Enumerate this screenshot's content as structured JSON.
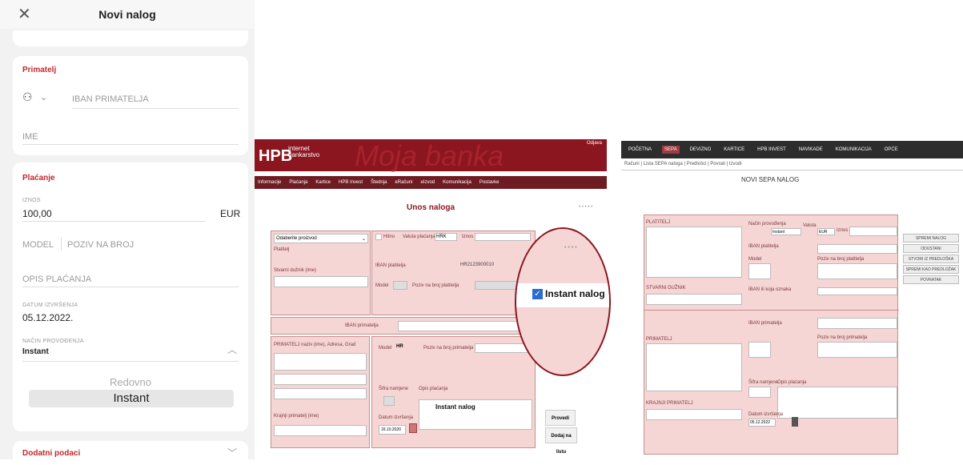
{
  "mobile": {
    "title": "Novi nalog",
    "primatelj_title": "Primatelj",
    "iban_placeholder": "IBAN PRIMATELJA",
    "ime_placeholder": "IME",
    "placanje_title": "Plaćanje",
    "iznos_label": "IZNOS",
    "iznos_value": "100,00",
    "currency": "EUR",
    "model_label": "MODEL",
    "poziv_label": "POZIV NA BROJ",
    "opis_label": "OPIS PLAĆANJA",
    "datum_label": "DATUM IZVRŠENJA",
    "datum_value": "05.12.2022.",
    "nacin_label": "NAČIN PROVOĐENJA",
    "nacin_value": "Instant",
    "option_redovno": "Redovno",
    "option_instant": "Instant",
    "dodatni": "Dodatni podaci"
  },
  "hpb_old": {
    "logo": "HPB",
    "logo_sub1": "internet",
    "logo_sub2": "bankarstvo",
    "watermark": "Moja banka",
    "odjava": "Odjava",
    "nav": [
      "Informacije",
      "Plaćanja",
      "Kartice",
      "HPB Invest",
      "Štednja",
      "eRačuni",
      "eIzvod",
      "Komunikacija",
      "Postavke"
    ],
    "page_title": "Unos naloga",
    "select_racun": "Odaberite proizvod",
    "hitno": "Hitno",
    "valuta_label": "Valuta plaćanja",
    "valuta": "HRK",
    "iznos_label": "Iznos",
    "platitelj": "Platitelj",
    "iban_platitelja_label": "IBAN platitelja",
    "iban_platitelja": "HR2123900010",
    "stvarni_duznik": "Stvarni dužnik (ime)",
    "model_label": "Model",
    "poziv_platitelja": "Poziv na broj platitelja",
    "iban_primatelja": "IBAN primatelja",
    "primatelj": "PRIMATELJ naziv (ime), Adresa, Grad",
    "model_primatelja": "Model",
    "model_hr": "HR",
    "poziv_primatelja": "Poziv na broj primatelja",
    "sifra_namjene": "Šifra namjene",
    "opis_placanja": "Opis plaćanja",
    "krajnji": "Krajnji primatelj (ime)",
    "datum_label": "Datum izvršenja",
    "datum": "16.10.2020",
    "instant_note": "Instant nalog",
    "zoom_checkbox": "Instant nalog",
    "btn_provedi": "Provedi",
    "btn_dodaj": "Dodaj na listu"
  },
  "hpb_sepa": {
    "nav": [
      "POČETNA",
      "SEPA",
      "DEVIZNO",
      "KARTICE",
      "HPB INVEST",
      "NAVIKADE",
      "KOMUNIKACIJA",
      "OPĆE"
    ],
    "nav_active": 1,
    "crumbs": "Računi  |  Lista SEPA naloga  |  Predlošci  |  Povrati  |  Izvodi",
    "title": "NOVI SEPA NALOG",
    "platitelj": "PLATITELJ",
    "nacin": "Način provođenja",
    "nacin_value": "Instant",
    "valuta": "Valuta",
    "valuta_value": "EUR",
    "iznos": "Iznos",
    "iban_platitelja": "IBAN platitelja",
    "model": "Model",
    "poziv_platitelja": "Poziv na broj platitelja",
    "stvarni_duznik": "STVARNI DUŽNIK",
    "bank_duznika": "IBAN ili koja oznaka",
    "iban_primatelja": "IBAN primatelja",
    "primatelj": "PRIMATELJ",
    "poziv_primatelja": "Poziv na broj primatelja",
    "sifra_namjene": "Šifra namjene",
    "opis_placanja": "Opis plaćanja",
    "krajnji": "KRAJNJI PRIMATELJ",
    "datum_label": "Datum izvršenja",
    "datum": "05.12.2022",
    "buttons": [
      "SPREMI NALOG",
      "ODUSTANI",
      "STVORI IZ PREDLOŠKA",
      "SPREMI KAO PREDLOŽAK",
      "POVRATAK"
    ]
  }
}
